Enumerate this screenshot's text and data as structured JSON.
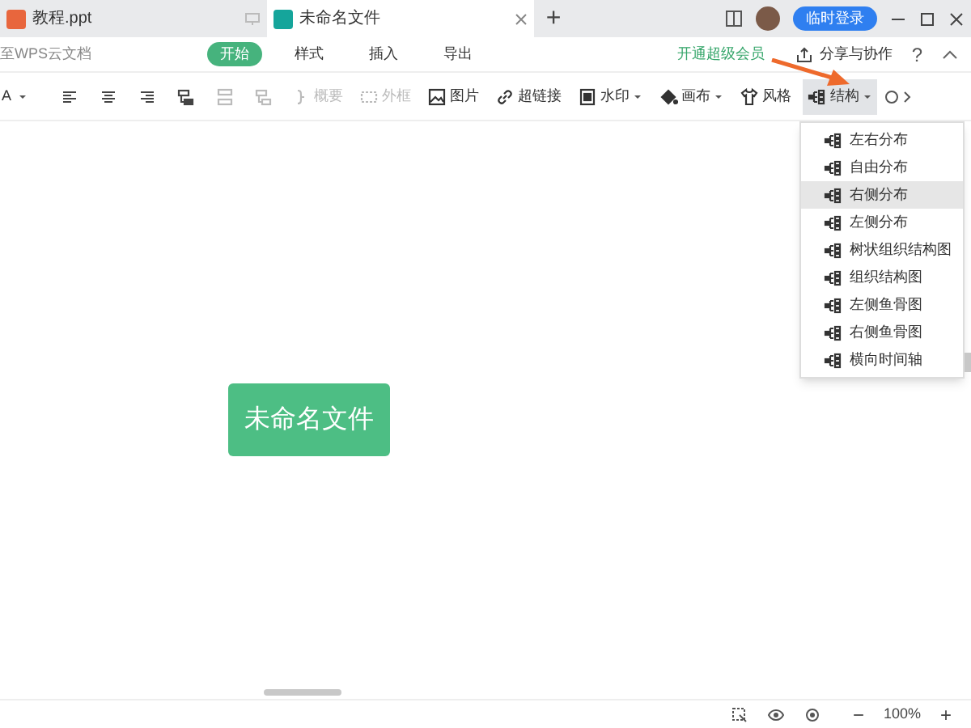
{
  "tabs": [
    {
      "title": "教程.ppt",
      "selected": false,
      "kind": "ppt"
    },
    {
      "title": "未命名文件",
      "selected": true,
      "kind": "mind"
    }
  ],
  "new_tab": "+",
  "login_button": "临时登录",
  "menu": {
    "left_text": "至WPS云文档",
    "items": [
      {
        "label": "开始",
        "selected": true
      },
      {
        "label": "样式",
        "selected": false
      },
      {
        "label": "插入",
        "selected": false
      },
      {
        "label": "导出",
        "selected": false
      }
    ],
    "vip": "开通超级会员",
    "share": "分享与协作",
    "help": "?"
  },
  "toolbar": [
    {
      "kind": "font",
      "label": "A"
    },
    {
      "kind": "icon",
      "disabled": false
    },
    {
      "kind": "icon",
      "disabled": false
    },
    {
      "kind": "icon",
      "disabled": false
    },
    {
      "kind": "icon",
      "disabled": false
    },
    {
      "kind": "icon",
      "disabled": true
    },
    {
      "kind": "icon",
      "disabled": true
    },
    {
      "kind": "button",
      "label": "概要",
      "disabled": true,
      "dropdown": false,
      "selected": false
    },
    {
      "kind": "button",
      "label": "外框",
      "disabled": true,
      "dropdown": false,
      "selected": false
    },
    {
      "kind": "button",
      "label": "图片",
      "disabled": false,
      "dropdown": false,
      "selected": false
    },
    {
      "kind": "button",
      "label": "超链接",
      "disabled": false,
      "dropdown": false,
      "selected": false
    },
    {
      "kind": "button",
      "label": "水印",
      "disabled": false,
      "dropdown": true,
      "selected": false
    },
    {
      "kind": "button",
      "label": "画布",
      "disabled": false,
      "dropdown": true,
      "selected": false
    },
    {
      "kind": "button",
      "label": "风格",
      "disabled": false,
      "dropdown": false,
      "selected": false
    },
    {
      "kind": "button",
      "label": "结构",
      "disabled": false,
      "dropdown": true,
      "selected": true
    }
  ],
  "structure_menu": [
    {
      "label": "左右分布",
      "selected": false
    },
    {
      "label": "自由分布",
      "selected": false
    },
    {
      "label": "右侧分布",
      "selected": true
    },
    {
      "label": "左侧分布",
      "selected": false
    },
    {
      "label": "树状组织结构图",
      "selected": false
    },
    {
      "label": "组织结构图",
      "selected": false
    },
    {
      "label": "左侧鱼骨图",
      "selected": false
    },
    {
      "label": "右侧鱼骨图",
      "selected": false
    },
    {
      "label": "横向时间轴",
      "selected": false
    }
  ],
  "root_node": "未命名文件",
  "status": {
    "zoom": "100%",
    "minus": "−",
    "plus": "+"
  }
}
